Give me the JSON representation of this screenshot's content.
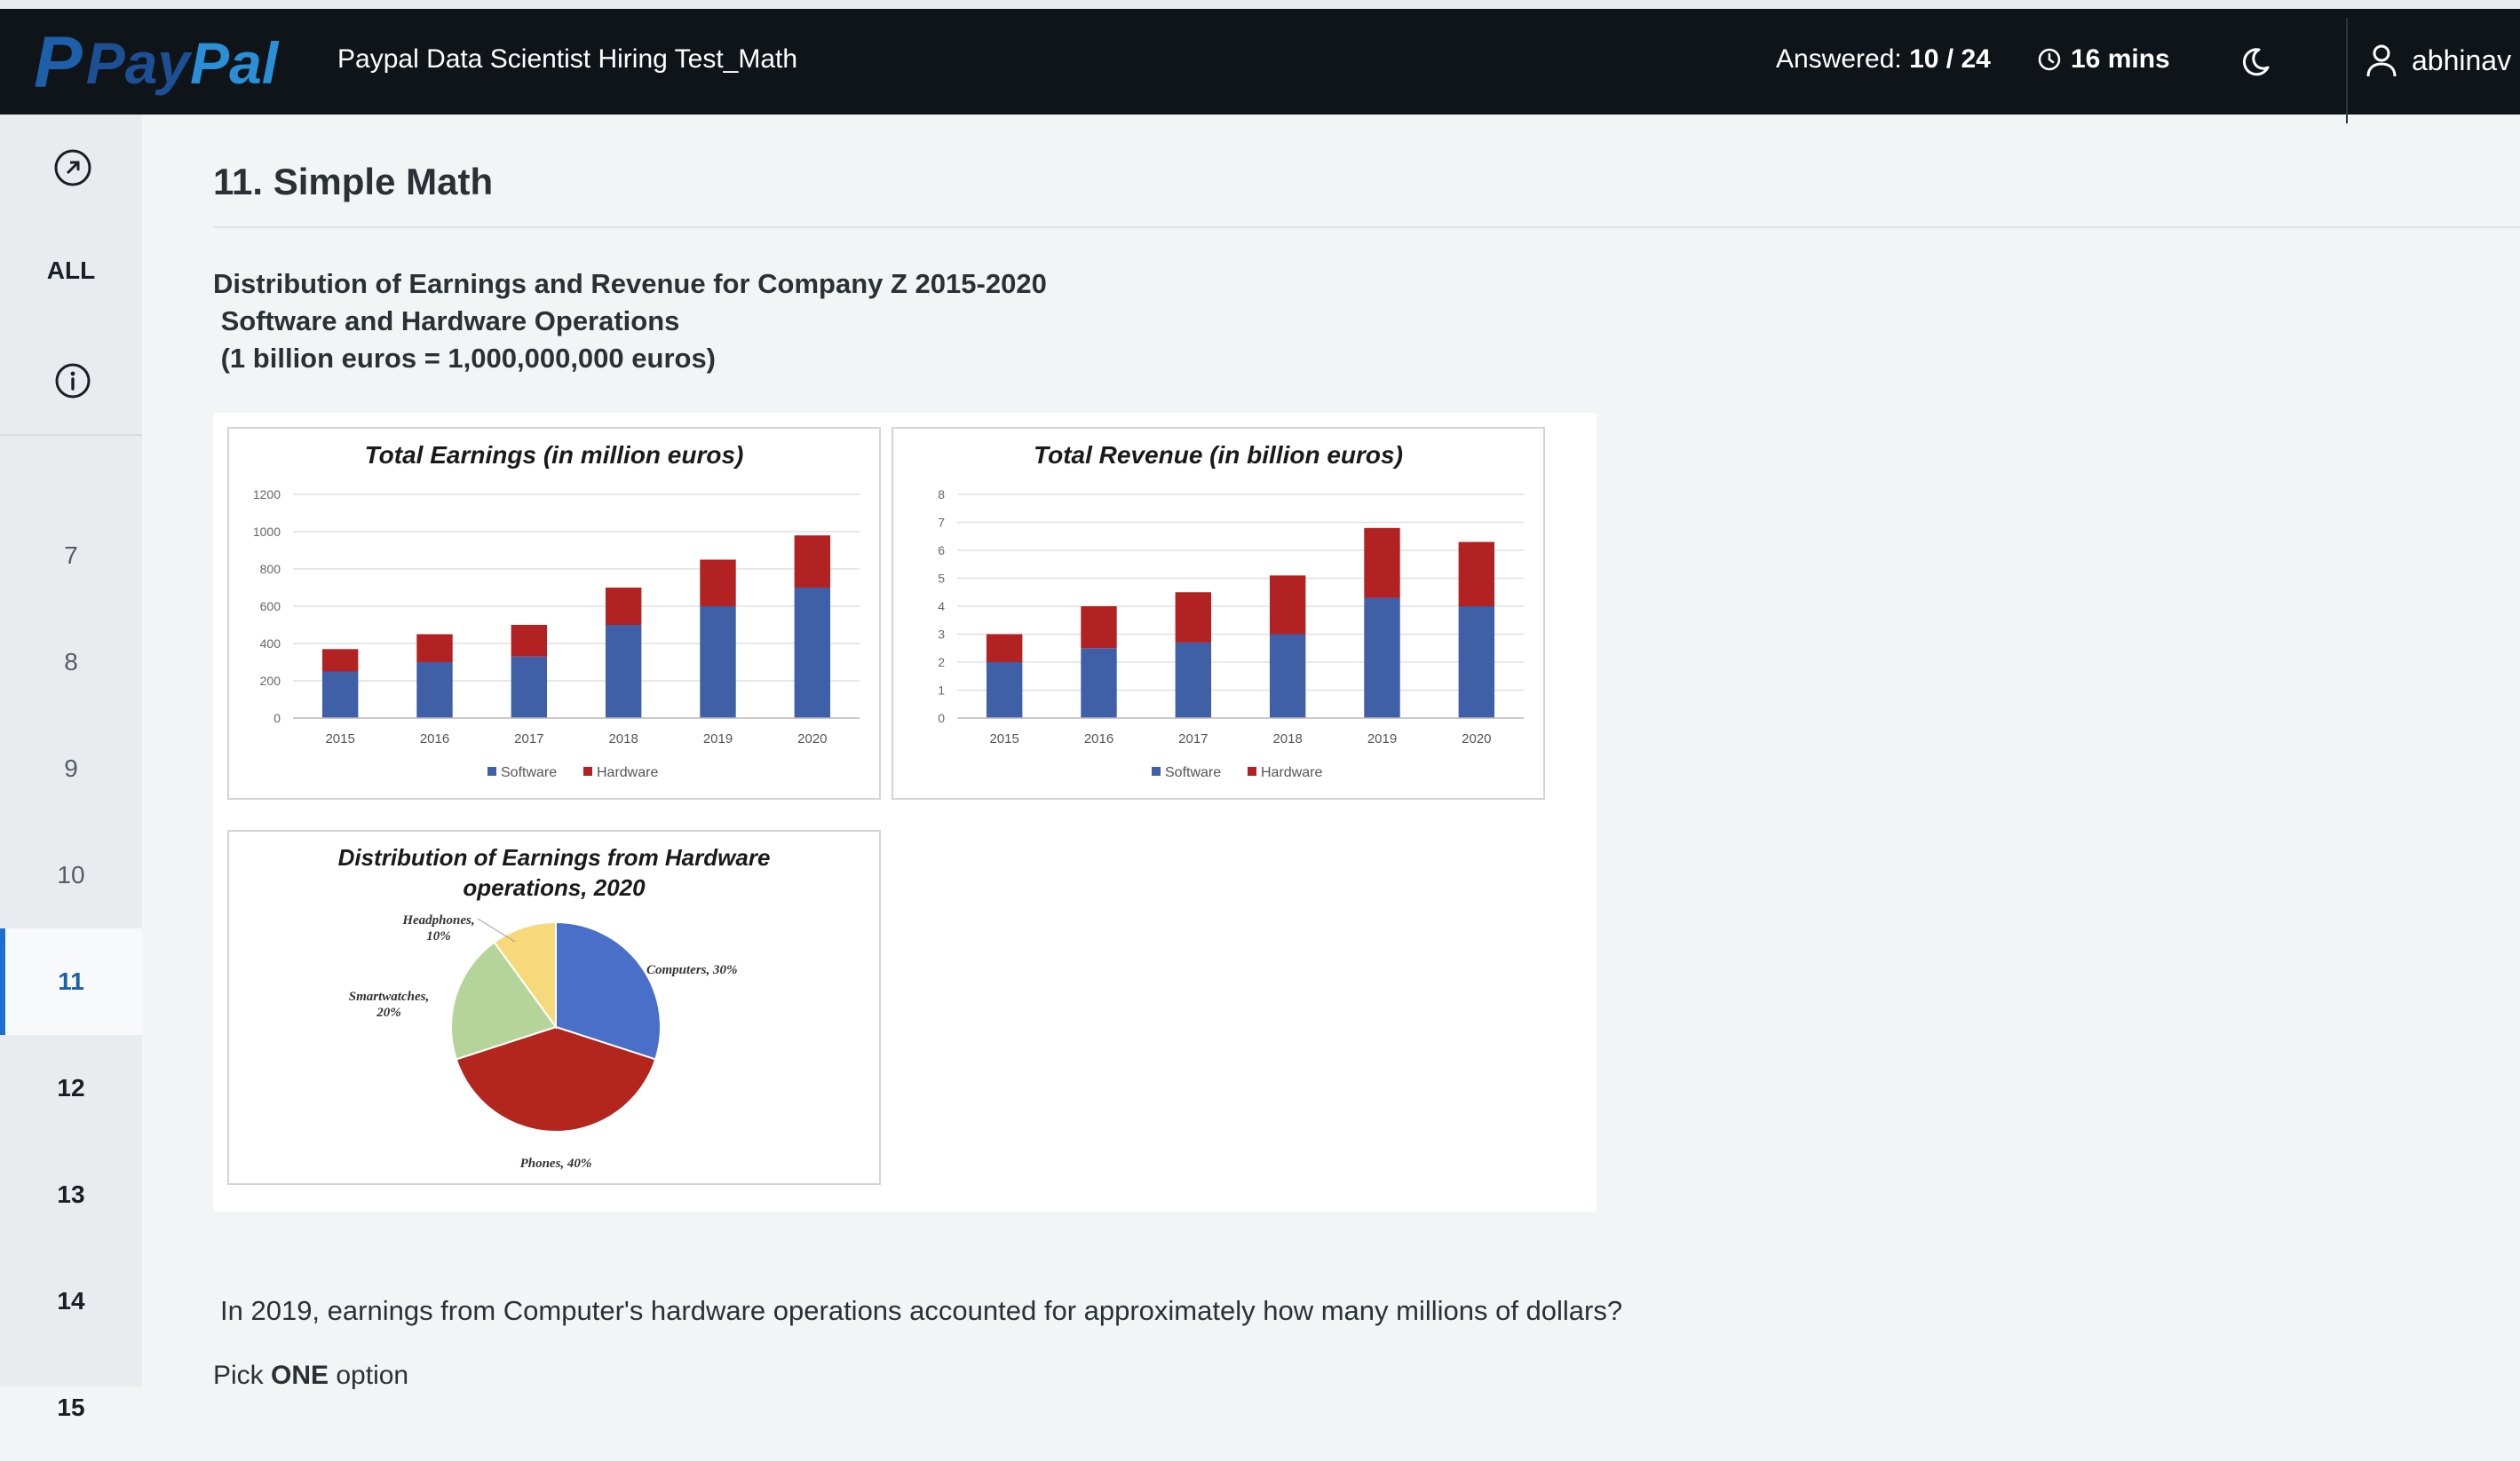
{
  "header": {
    "logo_p": "P",
    "logo_pay": "Pay",
    "logo_pal": "Pal",
    "test_title": "Paypal Data Scientist Hiring Test_Math",
    "answered_label": "Answered:",
    "answered_value": "10 / 24",
    "timer": "16 mins",
    "username": "abhinav"
  },
  "sidebar": {
    "all_label": "ALL",
    "questions": [
      "7",
      "8",
      "9",
      "10",
      "11",
      "12",
      "13",
      "14",
      "15"
    ],
    "active": "11"
  },
  "question": {
    "heading": "11. Simple Math",
    "desc_line1": "Distribution of Earnings and Revenue for Company Z 2015-2020",
    "desc_line2": " Software and Hardware Operations",
    "desc_line3": " (1 billion euros = 1,000,000,000 euros)",
    "text": "In 2019, earnings from Computer's hardware operations accounted for approximately how many millions of dollars?",
    "pick_prefix": "Pick ",
    "pick_bold": "ONE",
    "pick_suffix": " option"
  },
  "colors": {
    "software": "#3f5fa6",
    "hardware": "#b22222",
    "computers": "#4a6fc9",
    "phones": "#b3261e",
    "smartwatches": "#b5d49a",
    "headphones": "#f6d97a"
  },
  "chart_data": [
    {
      "type": "bar",
      "stacked": true,
      "title": "Total Earnings (in million euros)",
      "categories": [
        "2015",
        "2016",
        "2017",
        "2018",
        "2019",
        "2020"
      ],
      "series": [
        {
          "name": "Software",
          "values": [
            250,
            300,
            330,
            500,
            600,
            700
          ]
        },
        {
          "name": "Hardware",
          "values": [
            120,
            150,
            170,
            200,
            250,
            280
          ]
        }
      ],
      "ylim": [
        0,
        1200
      ],
      "yticks": [
        "0",
        "200",
        "400",
        "600",
        "800",
        "1000",
        "1200"
      ],
      "legend": "bottom",
      "grid": true
    },
    {
      "type": "bar",
      "stacked": true,
      "title": "Total Revenue (in billion euros)",
      "categories": [
        "2015",
        "2016",
        "2017",
        "2018",
        "2019",
        "2020"
      ],
      "series": [
        {
          "name": "Software",
          "values": [
            2,
            2.5,
            2.7,
            3,
            4.3,
            4
          ]
        },
        {
          "name": "Hardware",
          "values": [
            1,
            1.5,
            1.8,
            2.1,
            2.5,
            2.3
          ]
        }
      ],
      "ylim": [
        0,
        8
      ],
      "yticks": [
        "0",
        "1",
        "2",
        "3",
        "4",
        "5",
        "6",
        "7",
        "8"
      ],
      "legend": "bottom",
      "grid": true
    },
    {
      "type": "pie",
      "title_line1": "Distribution of Earnings from Hardware",
      "title_line2": "operations, 2020",
      "slices": [
        {
          "label": "Computers, 30%",
          "value": 30
        },
        {
          "label": "Phones, 40%",
          "value": 40
        },
        {
          "label": "Smartwatches, 20%",
          "value": 20
        },
        {
          "label": "Headphones, 10%",
          "value": 10
        }
      ]
    }
  ]
}
